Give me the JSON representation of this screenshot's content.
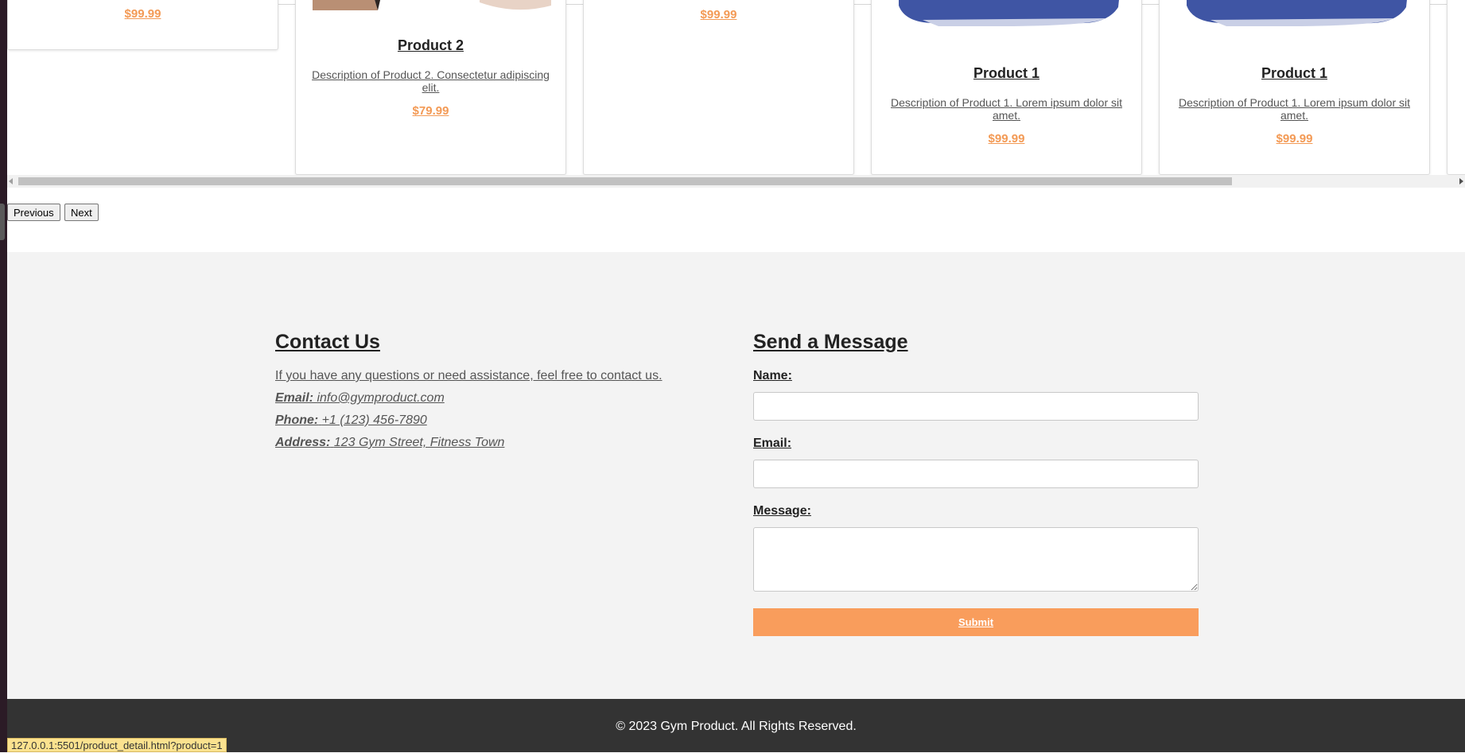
{
  "products_row": [
    {
      "name": "",
      "description": "",
      "price": "$99.99"
    },
    {
      "name": "Product 2",
      "description": "Description of Product 2. Consectetur adipiscing elit.",
      "price": "$79.99"
    },
    {
      "name": "",
      "description": "",
      "price": "$99.99"
    },
    {
      "name": "Product 1",
      "description": "Description of Product 1. Lorem ipsum dolor sit amet.",
      "price": "$99.99"
    },
    {
      "name": "Product 1",
      "description": "Description of Product 1. Lorem ipsum dolor sit amet.",
      "price": "$99.99"
    }
  ],
  "pagination": {
    "previous_label": "Previous",
    "next_label": "Next"
  },
  "contact": {
    "title": "Contact Us",
    "intro": "If you have any questions or need assistance, feel free to contact us.",
    "email_label": "Email:",
    "email_value": "info@gymproduct.com",
    "phone_label": "Phone:",
    "phone_value": "+1 (123) 456-7890",
    "address_label": "Address:",
    "address_value": "123 Gym Street, Fitness Town"
  },
  "message_form": {
    "title": "Send a Message",
    "name_label": "Name:",
    "email_label": "Email:",
    "message_label": "Message:",
    "submit_label": "Submit"
  },
  "footer": {
    "copyright": "© 2023 Gym Product. All Rights Reserved."
  },
  "status_bar": {
    "url": "127.0.0.1:5501/product_detail.html?product=1"
  },
  "colors": {
    "accent": "#f99d5c",
    "price": "#f39a55",
    "footer_bg": "#333333",
    "section_bg": "#f3f3f3"
  }
}
